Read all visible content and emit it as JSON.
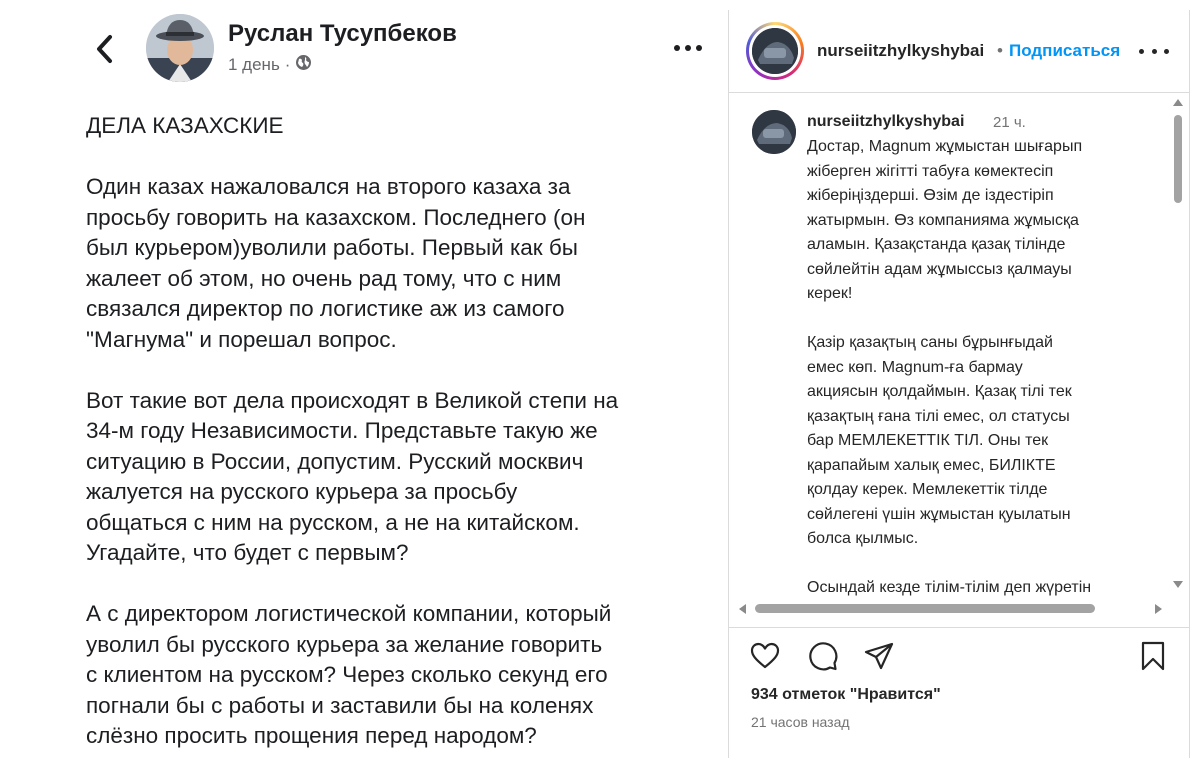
{
  "facebook": {
    "author_name": "Руслан Тусупбеков",
    "post_time": "1 день",
    "meta_separator": "·",
    "paragraphs": [
      [
        "ДЕЛА КАЗАХСКИЕ"
      ],
      [
        "Один казах нажаловался на второго казаха за",
        "просьбу говорить на казахском. Последнего (он",
        "был курьером)уволили работы. Первый как бы",
        "жалеет об этом, но очень рад тому, что с ним",
        "связался директор по логистике аж из самого",
        "\"Магнума\" и порешал вопрос."
      ],
      [
        "Вот такие вот дела происходят в Великой степи на",
        "34-м году Независимости. Представьте такую же",
        "ситуацию в России, допустим. Русский москвич",
        "жалуется на русского курьера за просьбу",
        "общаться с ним на русском, а не на китайском.",
        "Угадайте, что будет с первым?"
      ],
      [
        "А с директором логистической компании, который",
        "уволил бы русского курьера за желание говорить",
        "с клиентом на русском? Через сколько секунд его",
        "погнали бы с работы и заставили бы на коленях",
        "слёзно просить прощения перед народом?"
      ]
    ],
    "icons": {
      "back": "back-arrow-icon",
      "privacy": "globe-icon",
      "more": "more-options-icon"
    }
  },
  "instagram": {
    "username": "nurseiitzhylkyshybai",
    "separator": "•",
    "follow_label": "Подписаться",
    "comment_username": "nurseiitzhylkyshybai",
    "comment_time": "21 ч.",
    "caption_paragraphs": [
      [
        "Достар, Magnum жұмыстан шығарып",
        "жіберген жігітті табуға көмектесіп",
        "жіберіңіздерші. Өзім де іздестіріп",
        "жатырмын. Өз компанияма жұмысқа",
        "аламын. Қазақстанда қазақ тілінде",
        "сөйлейтін адам жұмыссыз қалмауы",
        "керек!"
      ],
      [
        "Қазір қазақтың саны бұрынғыдай",
        "емес көп. Magnum-ға бармау",
        "акциясын қолдаймын. Қазақ тілі тек",
        "қазақтың ғана тілі емес, ол статусы",
        "бар МЕМЛЕКЕТТІК ТІЛ. Оны тек",
        "қарапайым халық емес, БИЛІКТЕ",
        "қолдау керек. Мемлекеттік тілде",
        "сөйлегені үшін жұмыстан қуылатын",
        "болса қылмыс."
      ],
      [
        "Осындай кезде тілім-тілім деп жүретін"
      ]
    ],
    "likes": "934 отметок \"Нравится\"",
    "posted_ago": "21 часов назад",
    "colors": {
      "link": "#0095f6",
      "border": "#dbdbdb",
      "secondary_text": "#737373"
    },
    "icons": [
      "heart-icon",
      "comment-icon",
      "share-icon",
      "bookmark-icon"
    ]
  }
}
